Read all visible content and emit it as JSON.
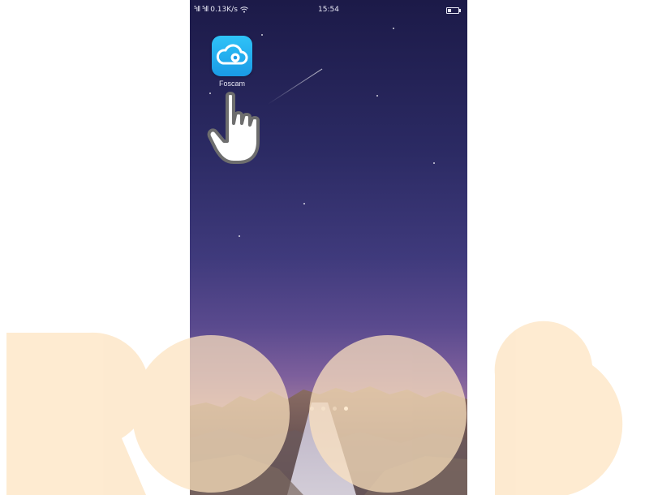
{
  "status_bar": {
    "signal_1": "⁵ıll",
    "signal_2": "⁵ıll",
    "network_speed": "0.13K/s",
    "time": "15:54",
    "battery_level_fraction": 0.35
  },
  "home_screen": {
    "apps": [
      {
        "label": "Foscam",
        "icon": "cloud-eye-icon"
      }
    ],
    "page_indicator": {
      "page_count": 4,
      "active_index": 3
    }
  },
  "overlay": {
    "pointer": "tap-hand-icon",
    "watermark": "watermark-logo"
  },
  "colors": {
    "app_icon_top": "#2fc3f7",
    "app_icon_bottom": "#1a9ae6",
    "watermark": "#fde3bf",
    "sky_top": "#1c1a48"
  }
}
